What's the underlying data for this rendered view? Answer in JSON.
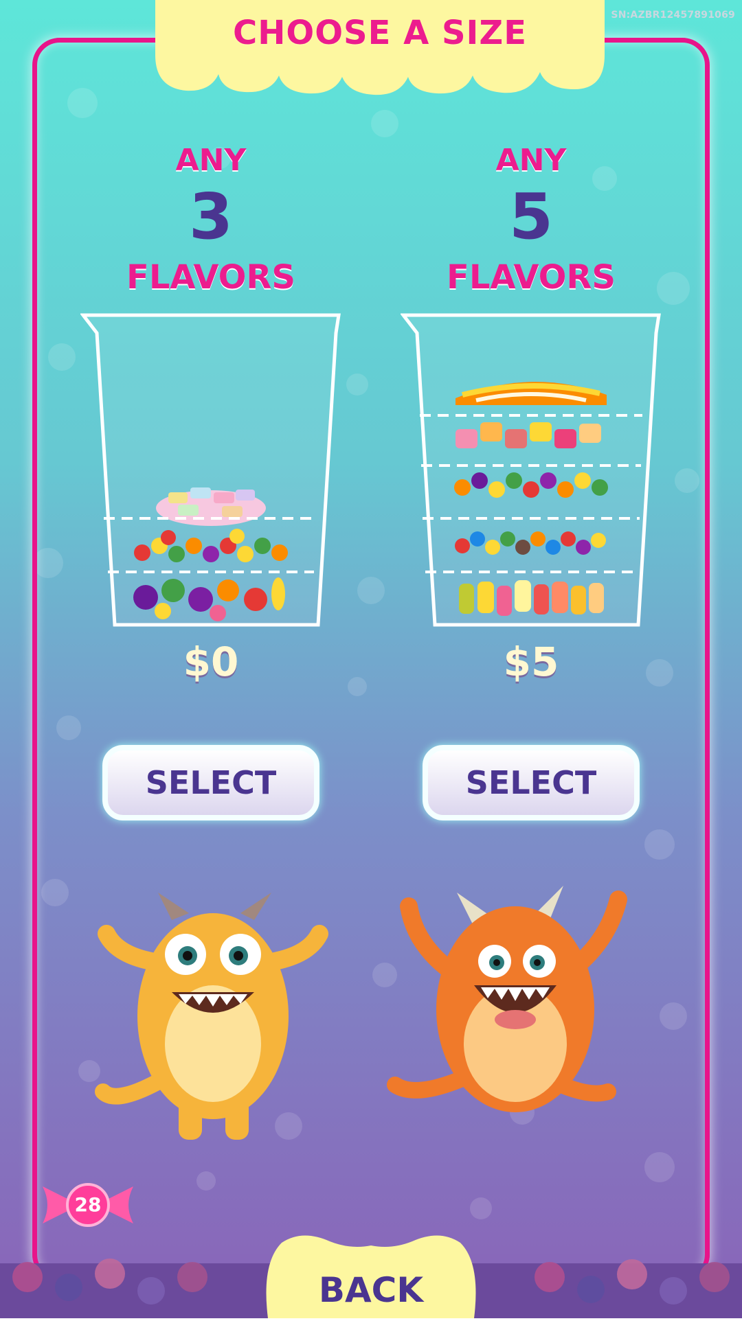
{
  "serial": "SN:AZBR12457891069",
  "header": {
    "title": "CHOOSE A SIZE"
  },
  "options": [
    {
      "any": "ANY",
      "count": "3",
      "flavors": "FLAVORS",
      "price": "$0",
      "select_label": "SELECT"
    },
    {
      "any": "ANY",
      "count": "5",
      "flavors": "FLAVORS",
      "price": "$5",
      "select_label": "SELECT"
    }
  ],
  "timer_badge": "28",
  "footer": {
    "back_label": "BACK"
  },
  "colors": {
    "accent_pink": "#ec1c8e",
    "text_purple": "#4a3590",
    "cap_yellow": "#fdf7a0",
    "bg_top": "#5ee6d9",
    "bg_bottom": "#8a63b8"
  },
  "icons": [
    "candy-cup-3-icon",
    "candy-cup-5-icon",
    "yellow-monster-icon",
    "orange-monster-icon",
    "candy-badge-icon"
  ]
}
